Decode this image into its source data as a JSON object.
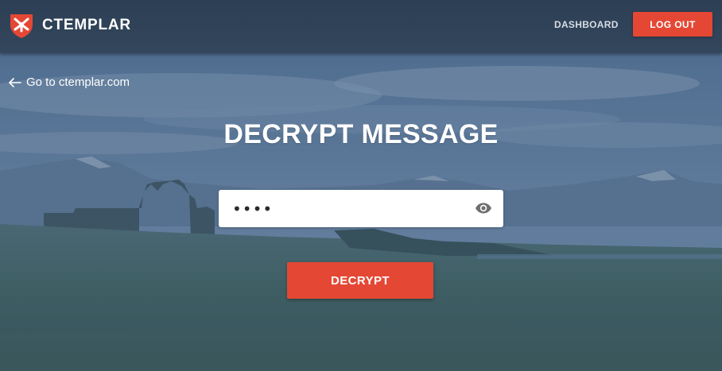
{
  "header": {
    "brand": "CTEMPLAR",
    "logo_icon": "shield-logo-icon",
    "nav": {
      "dashboard_label": "DASHBOARD"
    },
    "logout_label": "LOG OUT"
  },
  "back_link": {
    "label": "Go to ctemplar.com",
    "icon": "arrow-left-icon"
  },
  "main": {
    "title": "DECRYPT MESSAGE",
    "password": {
      "value": "••••",
      "toggle_icon": "eye-icon"
    },
    "decrypt_label": "DECRYPT"
  },
  "colors": {
    "header_bg": "#2f4258",
    "accent": "#e44834",
    "text_light": "#ffffff",
    "overlay": "#26446e"
  }
}
